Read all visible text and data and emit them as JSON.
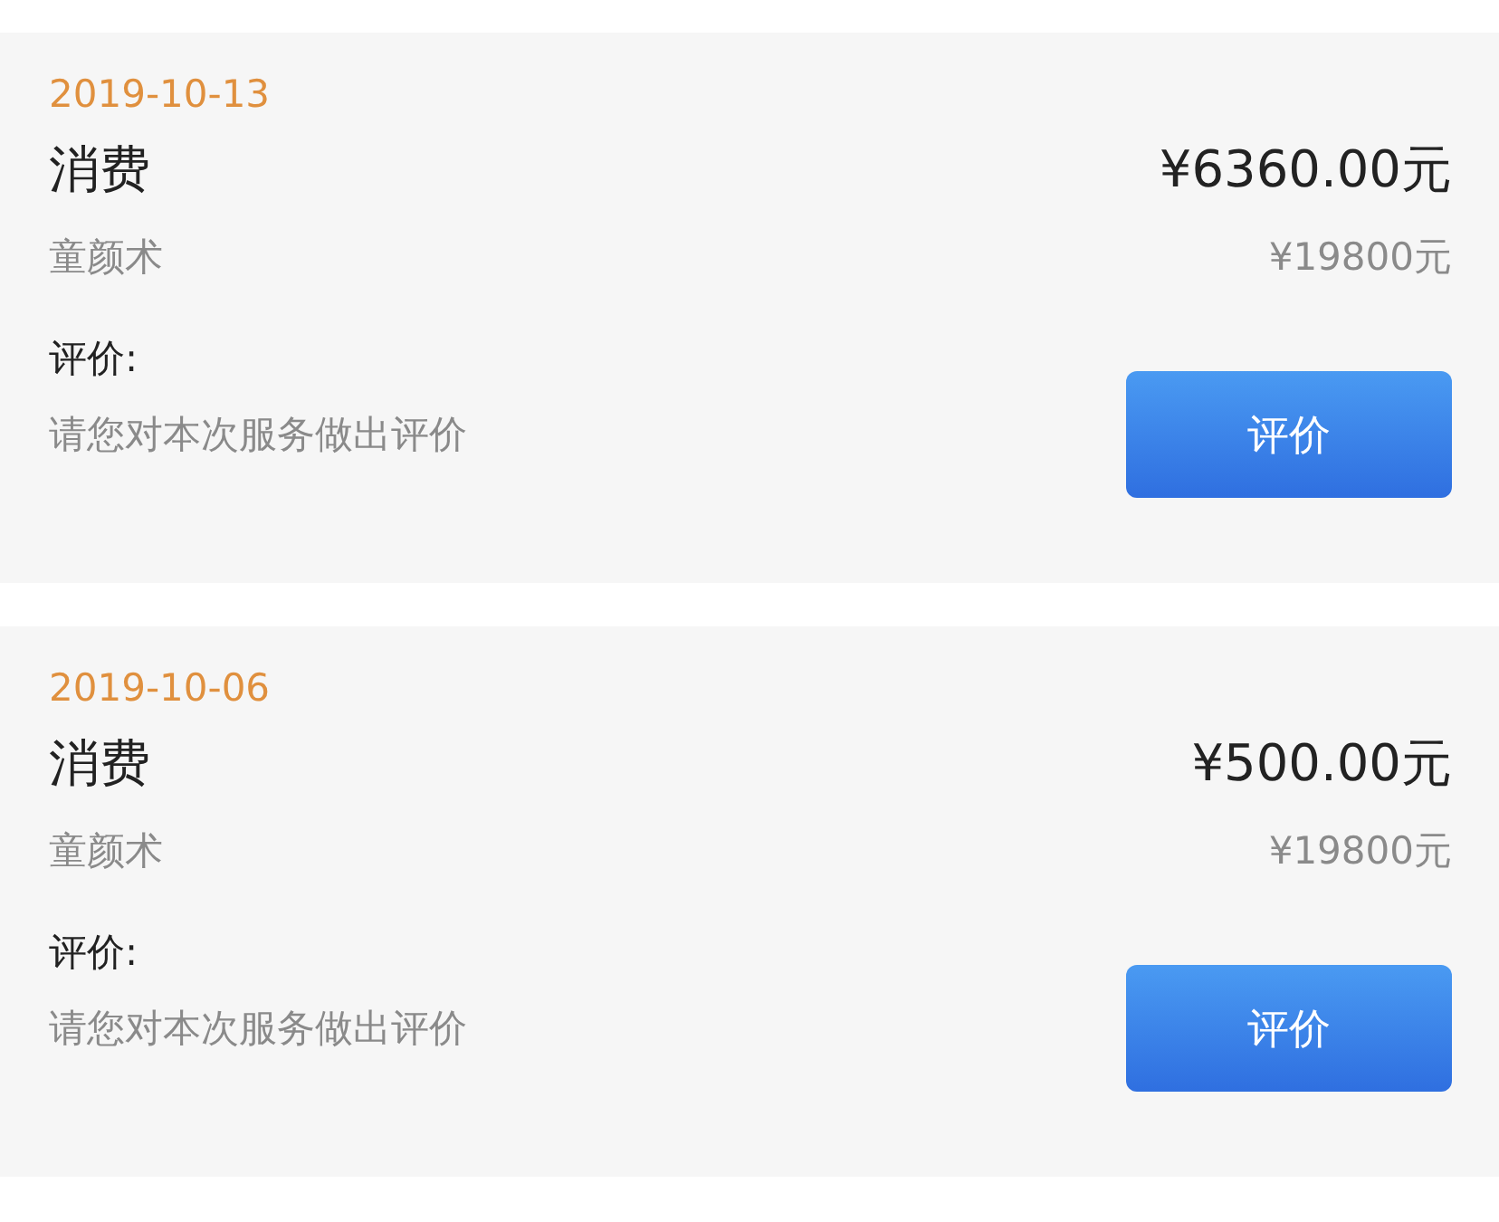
{
  "records": [
    {
      "date": "2019-10-13",
      "type": "消费",
      "amount": "¥6360.00元",
      "item": "童颜术",
      "price": "¥19800元",
      "review_label": "评价:",
      "review_prompt": "请您对本次服务做出评价",
      "button": "评价"
    },
    {
      "date": "2019-10-06",
      "type": "消费",
      "amount": "¥500.00元",
      "item": "童颜术",
      "price": "¥19800元",
      "review_label": "评价:",
      "review_prompt": "请您对本次服务做出评价",
      "button": "评价"
    }
  ]
}
